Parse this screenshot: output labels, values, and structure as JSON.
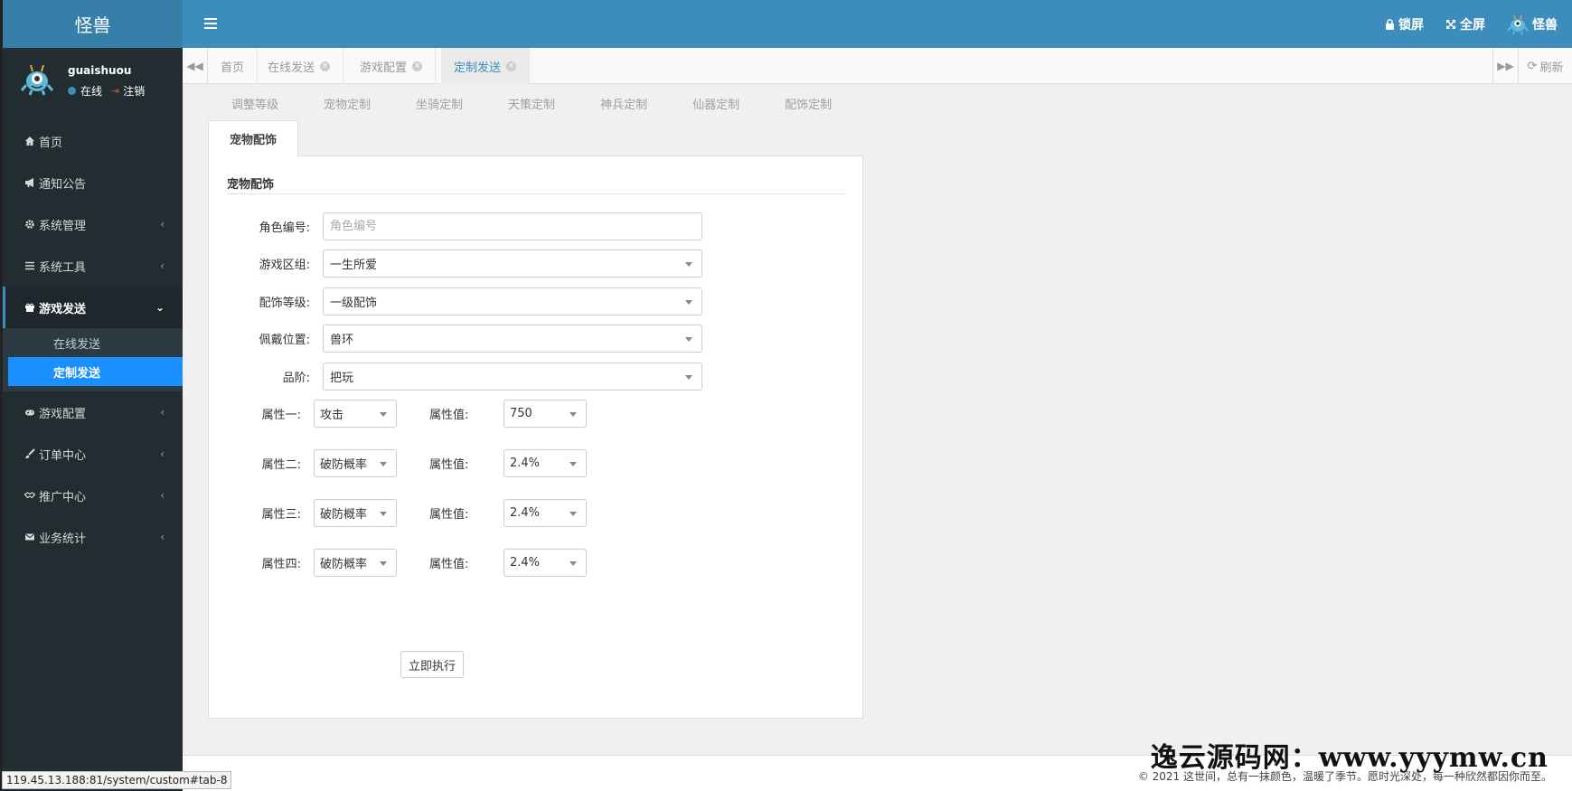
{
  "app": {
    "logo_text": "怪兽"
  },
  "header": {
    "lock_label": "锁屏",
    "fullscreen_label": "全屏",
    "user_label": "怪兽"
  },
  "sidebar": {
    "user": {
      "name": "guaishuou",
      "status": "在线",
      "logout": "注销"
    },
    "items": [
      {
        "label": "首页",
        "icon": "home-icon"
      },
      {
        "label": "通知公告",
        "icon": "bullhorn-icon"
      },
      {
        "label": "系统管理",
        "icon": "gear-icon"
      },
      {
        "label": "系统工具",
        "icon": "bars-icon"
      },
      {
        "label": "游戏发送",
        "icon": "gift-icon"
      },
      {
        "label": "游戏配置",
        "icon": "gamepad-icon"
      },
      {
        "label": "订单中心",
        "icon": "brush-icon"
      },
      {
        "label": "推广中心",
        "icon": "handshake-icon"
      },
      {
        "label": "业务统计",
        "icon": "envelope-icon"
      }
    ],
    "subitems": [
      {
        "label": "在线发送"
      },
      {
        "label": "定制发送"
      }
    ]
  },
  "tabs": {
    "items": [
      {
        "label": "首页"
      },
      {
        "label": "在线发送"
      },
      {
        "label": "游戏配置"
      },
      {
        "label": "定制发送"
      }
    ],
    "refresh_label": "刷新"
  },
  "subnav": [
    "调整等级",
    "宠物定制",
    "坐骑定制",
    "天策定制",
    "神兵定制",
    "仙器定制",
    "配饰定制"
  ],
  "panel": {
    "tab_label": "宠物配饰",
    "legend": "宠物配饰",
    "fields": {
      "role_id": {
        "label": "角色编号:",
        "placeholder": "角色编号",
        "value": ""
      },
      "server": {
        "label": "游戏区组:",
        "value": "一生所爱"
      },
      "level": {
        "label": "配饰等级:",
        "value": "一级配饰"
      },
      "position": {
        "label": "佩戴位置:",
        "value": "兽环"
      },
      "grade": {
        "label": "品阶:",
        "value": "把玩"
      }
    },
    "attributes": [
      {
        "label": "属性一:",
        "attr": "攻击",
        "value_label": "属性值:",
        "value": "750"
      },
      {
        "label": "属性二:",
        "attr": "破防概率",
        "value_label": "属性值:",
        "value": "2.4%"
      },
      {
        "label": "属性三:",
        "attr": "破防概率",
        "value_label": "属性值:",
        "value": "2.4%"
      },
      {
        "label": "属性四:",
        "attr": "破防概率",
        "value_label": "属性值:",
        "value": "2.4%"
      }
    ],
    "submit_label": "立即执行"
  },
  "footer": {
    "copyright": "© 2021 这世间，总有一抹颜色，温暖了季节。愿时光深处，每一种欣然都因你而至。"
  },
  "watermark": "逸云源码网：www.yyymw.cn",
  "statusbar": "119.45.13.188:81/system/custom#tab-8",
  "colors": {
    "header": "#3c8dbc",
    "sidebar": "#222d32",
    "active_sub": "#1890ff"
  }
}
